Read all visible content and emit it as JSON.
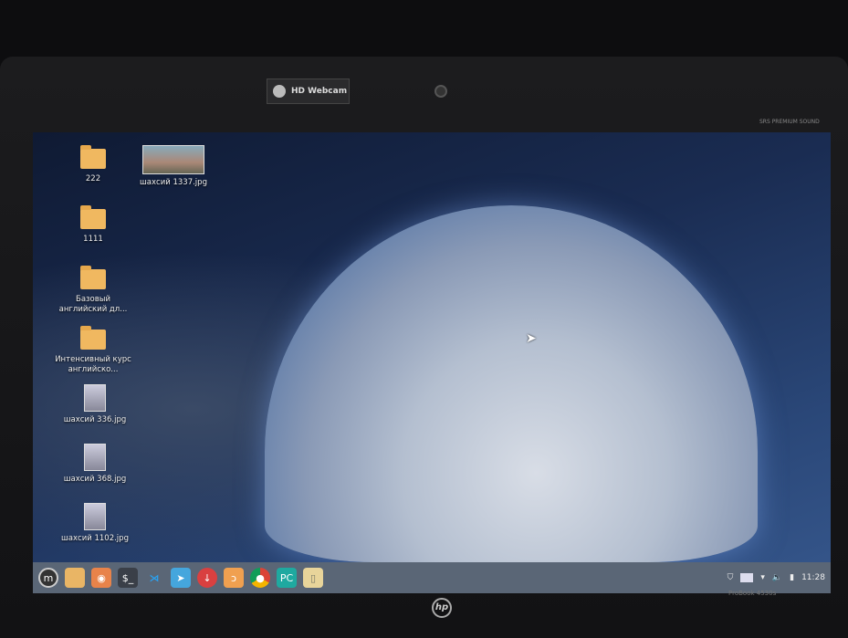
{
  "bezel": {
    "webcam_label": "HD Webcam",
    "audio_badge": "SRS PREMIUM SOUND",
    "brand": "hp",
    "model": "ProBook 4530s"
  },
  "desktop": {
    "icons": [
      {
        "label": "222",
        "type": "folder"
      },
      {
        "label": "1111",
        "type": "folder"
      },
      {
        "label": "Базовый английский дл...",
        "type": "folder"
      },
      {
        "label": "Интенсивный курс английско...",
        "type": "folder"
      },
      {
        "label": "шахсий 336.jpg",
        "type": "image"
      },
      {
        "label": "шахсий 368.jpg",
        "type": "image"
      },
      {
        "label": "шахсий 1102.jpg",
        "type": "image"
      },
      {
        "label": "шахсий 1337.jpg",
        "type": "image"
      }
    ]
  },
  "taskbar": {
    "apps": [
      "menu",
      "files",
      "firefox",
      "terminal",
      "vscode",
      "telegram",
      "downloader",
      "blender",
      "chrome",
      "pycharm",
      "text-editor"
    ],
    "clock": "11:28"
  }
}
